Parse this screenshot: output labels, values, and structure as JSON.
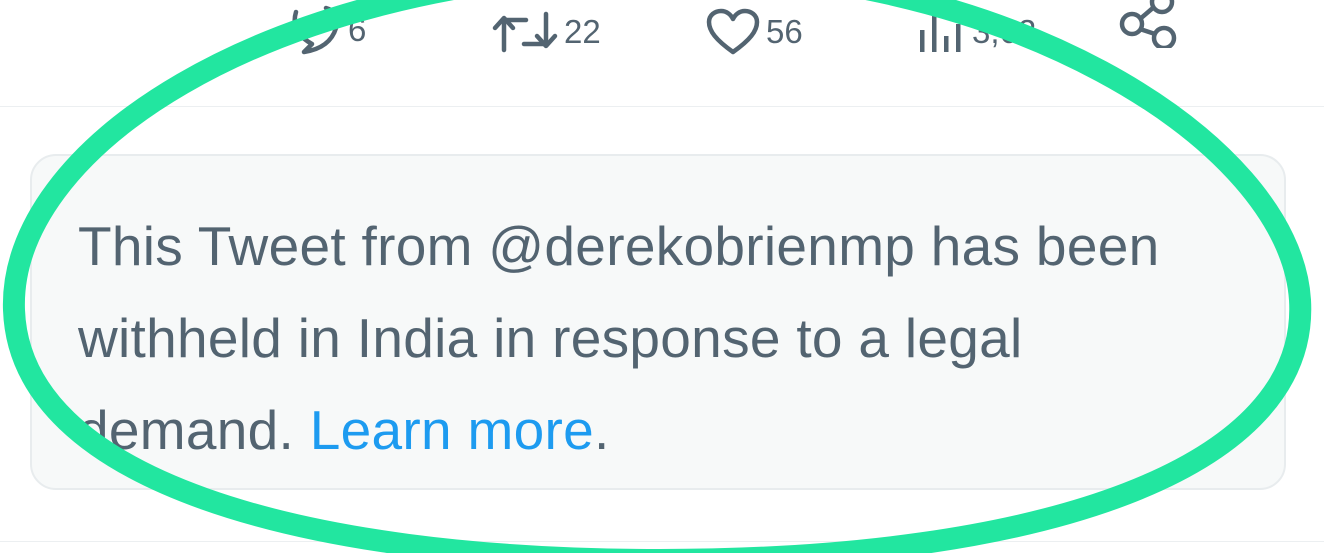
{
  "tweet_actions": {
    "reply_count": "6",
    "retweet_count": "22",
    "like_count": "56",
    "views_count": "3,62",
    "icons": {
      "reply": "speech-bubble-icon",
      "retweet": "retweet-arrows-icon",
      "like": "heart-icon",
      "views": "bar-chart-icon",
      "share": "share-icon"
    }
  },
  "withheld_notice": {
    "message": "This Tweet from @derekobrienmp has been withheld in India in response to a legal demand.",
    "link_label": "Learn more",
    "trailing": "."
  },
  "colors": {
    "secondary_text": "#536471",
    "link": "#1d9bf0",
    "notice_background": "#f7f9f9",
    "highlight_ellipse": "#22e6a0"
  }
}
